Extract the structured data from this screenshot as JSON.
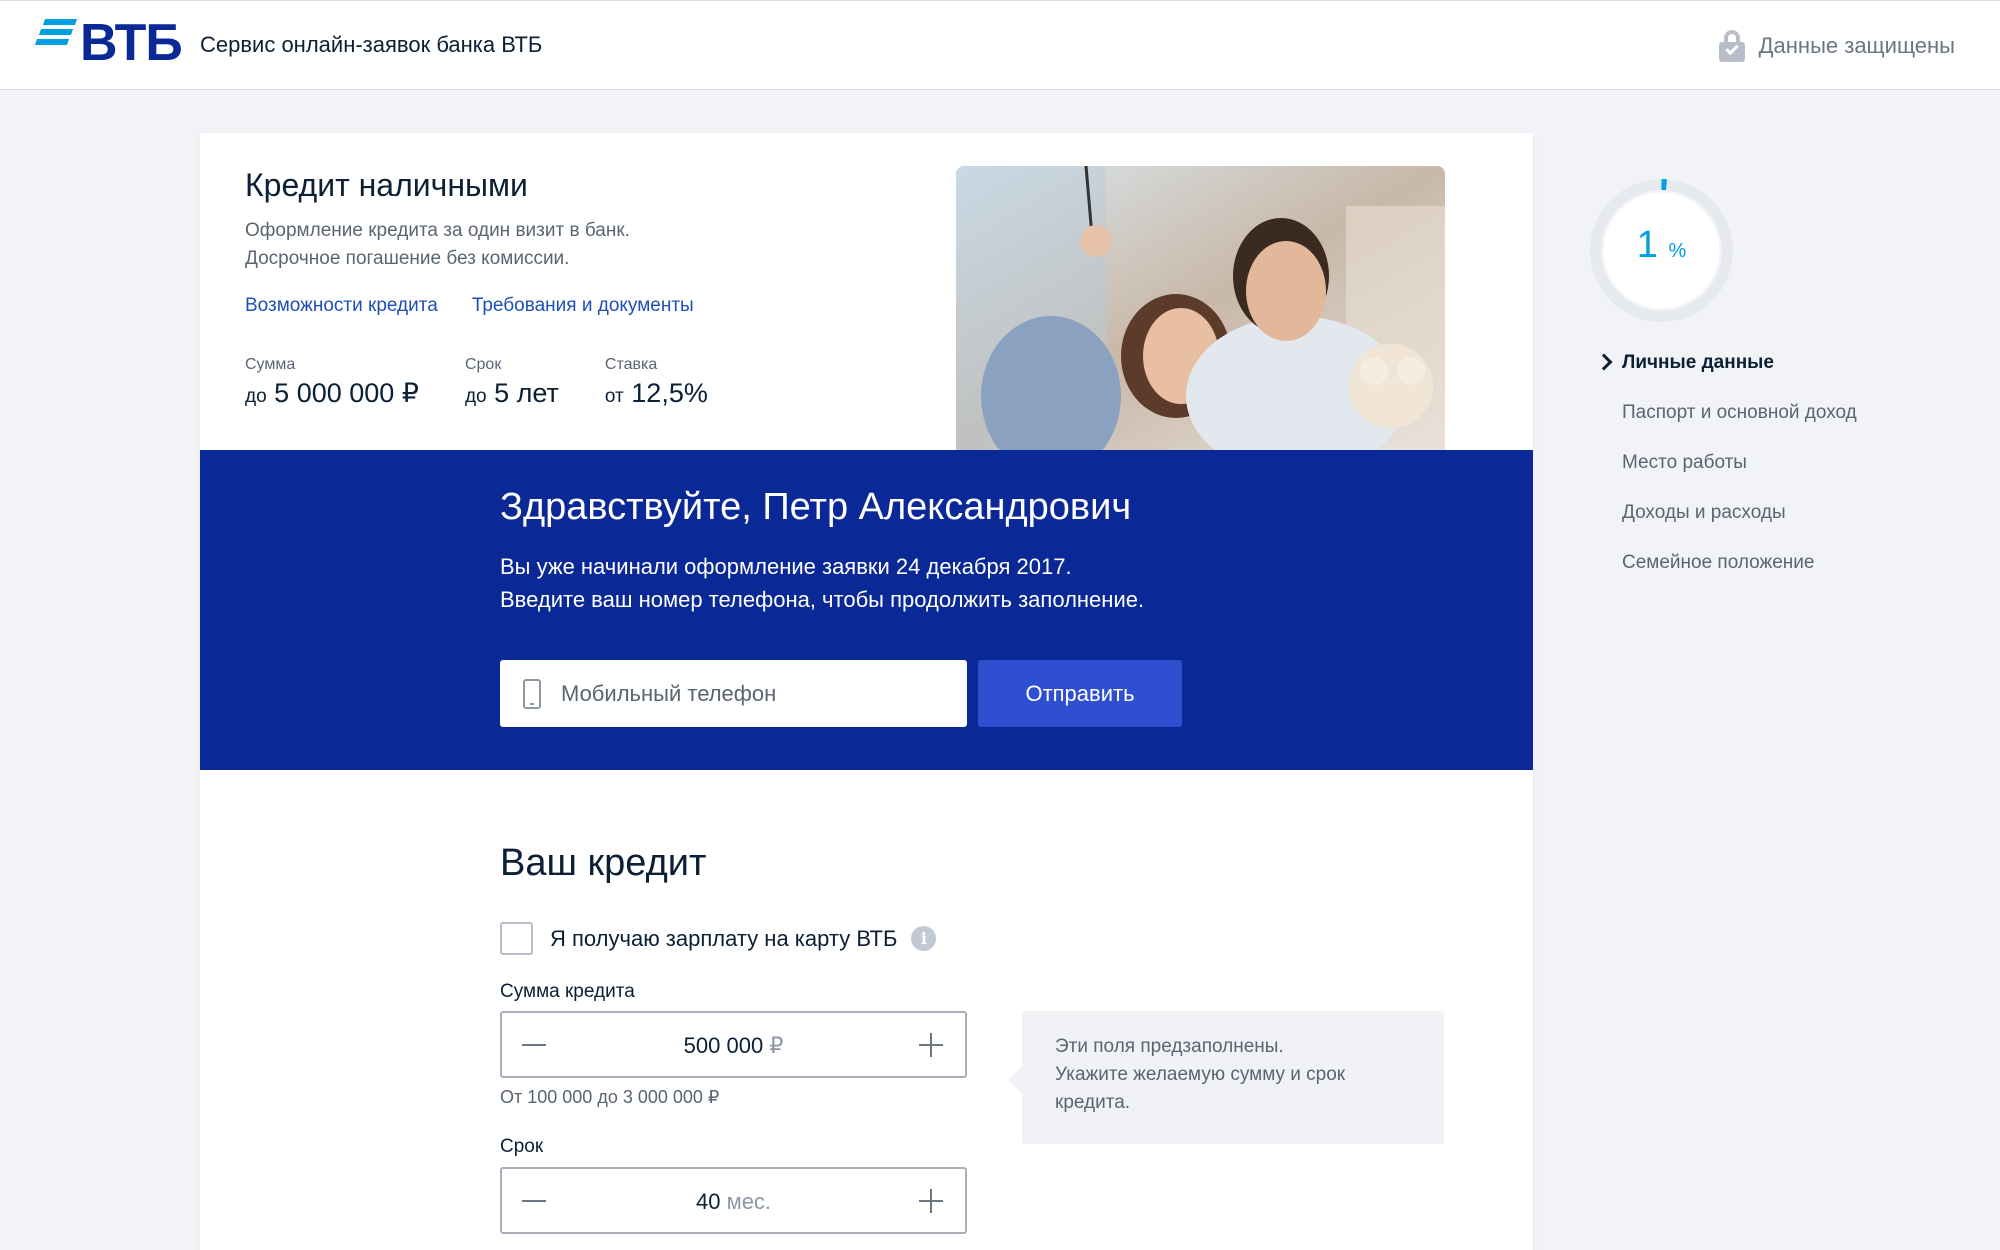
{
  "header": {
    "logo_text": "ВТБ",
    "service_title": "Сервис онлайн-заявок банка ВТБ",
    "secure_label": "Данные защищены"
  },
  "product": {
    "title": "Кредит наличными",
    "description_line1": "Оформление кредита за один визит в банк.",
    "description_line2": "Досрочное погашение без комиссии.",
    "links": [
      "Возможности кредита",
      "Требования и документы"
    ],
    "params": [
      {
        "label": "Сумма",
        "prefix": "до",
        "value": "5 000 000 ₽"
      },
      {
        "label": "Срок",
        "prefix": "до",
        "value": "5 лет"
      },
      {
        "label": "Ставка",
        "prefix": "от",
        "value": "12,5%"
      }
    ]
  },
  "welcome": {
    "greeting": "Здравствуйте, Петр Александрович",
    "line1": "Вы уже начинали оформление заявки 24 декабря 2017.",
    "line2": "Введите ваш номер телефона, чтобы продолжить заполнение.",
    "phone_placeholder": "Мобильный телефон",
    "submit_label": "Отправить"
  },
  "credit": {
    "section_title": "Ваш кредит",
    "salary_checkbox_label": "Я получаю зарплату на карту ВТБ",
    "salary_checked": false,
    "amount_label": "Сумма кредита",
    "amount_value": "500 000",
    "amount_unit": "₽",
    "amount_hint": "От 100 000 до 3 000 000 ₽",
    "term_label": "Срок",
    "term_value": "40",
    "term_unit": "мес.",
    "tooltip_line1": "Эти поля предзаполнены.",
    "tooltip_line2": "Укажите желаемую сумму и срок кредита."
  },
  "progress": {
    "percent_value": "1",
    "percent_sign": "%",
    "fraction": 0.01,
    "steps": [
      "Личные данные",
      "Паспорт и основной доход",
      "Место работы",
      "Доходы и расходы",
      "Семейное положение"
    ],
    "active_step": 0
  },
  "colors": {
    "brand_blue": "#0a2896",
    "accent_cyan": "#009fdf",
    "button_blue": "#2f4fd1"
  }
}
